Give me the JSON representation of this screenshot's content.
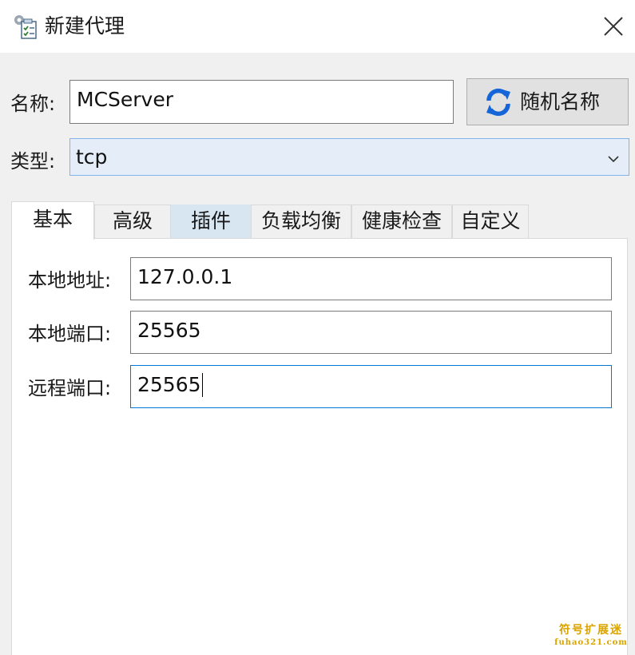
{
  "window": {
    "title": "新建代理",
    "icon": "proxy-config-icon",
    "close_icon": "close-icon"
  },
  "form": {
    "name_label": "名称:",
    "name_value": "MCServer",
    "random_name_button": "随机名称",
    "random_name_icon": "refresh-icon",
    "type_label": "类型:",
    "type_value": "tcp"
  },
  "tabs": [
    {
      "label": "基本",
      "active": true
    },
    {
      "label": "高级",
      "active": false
    },
    {
      "label": "插件",
      "active": false,
      "hover": true
    },
    {
      "label": "负载均衡",
      "active": false
    },
    {
      "label": "健康检查",
      "active": false
    },
    {
      "label": "自定义",
      "active": false
    }
  ],
  "basic": {
    "local_addr_label": "本地地址:",
    "local_addr_value": "127.0.0.1",
    "local_port_label": "本地端口:",
    "local_port_value": "25565",
    "remote_port_label": "远程端口:",
    "remote_port_value": "25565"
  },
  "watermark": {
    "line1": "符号扩展迷",
    "line2": "fuhao321.com"
  },
  "colors": {
    "focus_border": "#0078d7",
    "refresh_icon": "#1565d8",
    "select_bg": "#e5eef8",
    "tab_hover_bg": "#d8e6f2",
    "watermark": "#d9a400"
  }
}
